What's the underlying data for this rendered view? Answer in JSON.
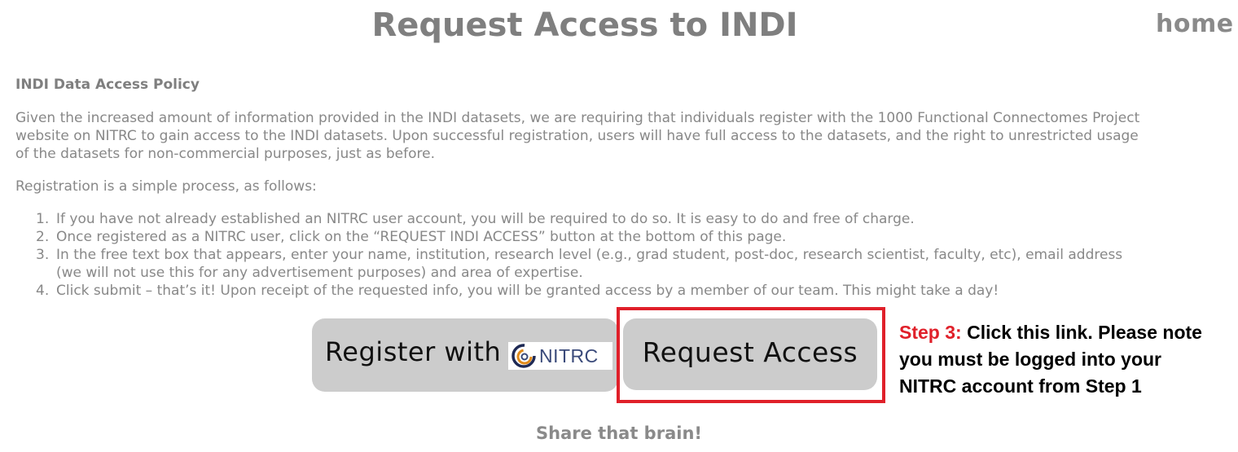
{
  "header": {
    "title": "Request Access to INDI",
    "home_link": "home"
  },
  "policy": {
    "heading": "INDI Data Access Policy",
    "intro_lines": [
      "Given the increased amount of information provided in the INDI datasets, we are requiring that individuals register with the 1000 Functional Connectomes Project",
      "website on NITRC to gain access to the INDI datasets. Upon successful registration, users will have full access to the datasets, and the right to unrestricted usage",
      "of the datasets for non-commercial purposes, just as before."
    ],
    "process_intro": "Registration is a simple process, as follows:",
    "steps": [
      {
        "num": "1.",
        "lines": [
          "If you have not already established an NITRC user account, you will be required to do so. It is easy to do and free of charge."
        ]
      },
      {
        "num": "2.",
        "lines": [
          "Once registered as a NITRC user, click on the “REQUEST INDI ACCESS” button at the bottom of this page."
        ]
      },
      {
        "num": "3.",
        "lines": [
          "In the free text box that appears, enter your name, institution, research level (e.g., grad student, post-doc, research scientist, faculty, etc), email address",
          "(we will not use this for any advertisement purposes) and area of expertise."
        ]
      },
      {
        "num": "4.",
        "lines": [
          "Click submit – that’s it! Upon receipt of the requested info, you will be granted access by a member of our team. This might take a day!"
        ]
      }
    ]
  },
  "buttons": {
    "register_label": "Register with",
    "nitrc_logo_text": "NITRC",
    "request_label": "Request Access"
  },
  "annotation": {
    "step_label": "Step 3:",
    "lines": [
      "Click this link. Please note",
      "you must be logged into your",
      "NITRC account from Step 1"
    ]
  },
  "footer": {
    "text": "Share that brain!"
  },
  "colors": {
    "accent_red": "#e0202a",
    "button_bg": "#cccccc",
    "text_gray": "#888888"
  }
}
